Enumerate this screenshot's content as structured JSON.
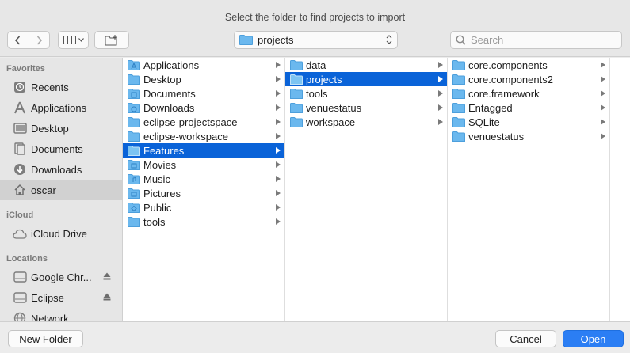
{
  "dialog": {
    "prompt": "Select the folder to find projects to import"
  },
  "toolbar": {
    "back_icon": "chevron-left-icon",
    "forward_icon": "chevron-right-icon",
    "view_icon": "column-view-icon",
    "new_folder_icon": "new-folder-icon",
    "path_popup": "projects",
    "search_placeholder": "Search"
  },
  "sidebar": {
    "favorites_header": "Favorites",
    "favorites": [
      {
        "label": "Recents",
        "icon": "clock-icon"
      },
      {
        "label": "Applications",
        "icon": "applications-icon"
      },
      {
        "label": "Desktop",
        "icon": "desktop-icon"
      },
      {
        "label": "Documents",
        "icon": "documents-icon"
      },
      {
        "label": "Downloads",
        "icon": "downloads-icon"
      },
      {
        "label": "oscar",
        "icon": "home-icon"
      }
    ],
    "icloud_header": "iCloud",
    "icloud": [
      {
        "label": "iCloud Drive",
        "icon": "cloud-icon"
      }
    ],
    "locations_header": "Locations",
    "locations": [
      {
        "label": "Google Chr...",
        "icon": "disk-icon"
      },
      {
        "label": "Eclipse",
        "icon": "disk-icon"
      },
      {
        "label": "Network",
        "icon": "network-icon"
      }
    ]
  },
  "columns": {
    "col1": [
      "Applications",
      "Desktop",
      "Documents",
      "Downloads",
      "eclipse-projectspace",
      "eclipse-workspace",
      "Features",
      "Movies",
      "Music",
      "Pictures",
      "Public",
      "tools"
    ],
    "col2": [
      "data",
      "projects",
      "tools",
      "venuestatus",
      "workspace"
    ],
    "col3": [
      "core.components",
      "core.components2",
      "core.framework",
      "Entagged",
      "SQLite",
      "venuestatus"
    ]
  },
  "selection": {
    "col1": "Features",
    "col2": "projects"
  },
  "buttons": {
    "new_folder": "New Folder",
    "cancel": "Cancel",
    "open": "Open"
  },
  "colors": {
    "accent": "#0a63d8",
    "folder": "#6bb8ee",
    "open_button": "#2b7ef4"
  }
}
